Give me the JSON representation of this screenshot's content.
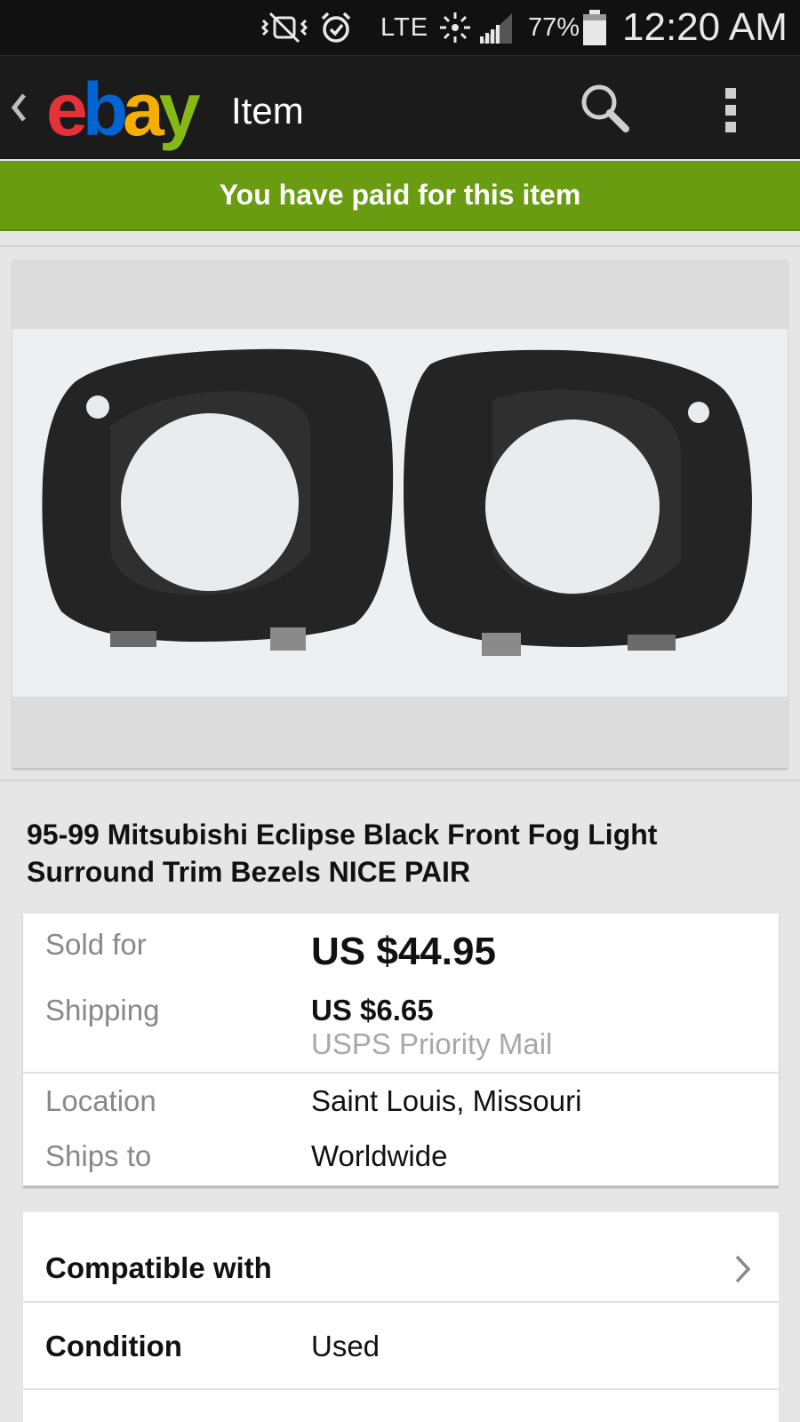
{
  "status_bar": {
    "network": "LTE",
    "battery_percent": "77%",
    "time": "12:20 AM",
    "icons": [
      "mute-vibrate-icon",
      "alarm-icon",
      "sync-icon",
      "signal-icon",
      "battery-icon"
    ]
  },
  "action_bar": {
    "logo": "ebay",
    "title": "Item",
    "icons": [
      "back-chevron-icon",
      "search-icon",
      "overflow-menu-icon"
    ]
  },
  "banner": {
    "text": "You have paid for this item",
    "color": "#699c10"
  },
  "item": {
    "title": "95-99 Mitsubishi Eclipse Black Front Fog Light Surround Trim Bezels NICE PAIR"
  },
  "pricing": {
    "sold_label": "Sold for",
    "sold_value": "US $44.95",
    "shipping_label": "Shipping",
    "shipping_value": "US $6.65",
    "shipping_method": "USPS Priority Mail",
    "location_label": "Location",
    "location_value": "Saint Louis, Missouri",
    "ships_to_label": "Ships to",
    "ships_to_value": "Worldwide"
  },
  "details": {
    "compatible_label": "Compatible with",
    "condition_label": "Condition",
    "condition_value": "Used"
  },
  "colors": {
    "ebay_red": "#e53238",
    "ebay_blue": "#0064d2",
    "ebay_yellow": "#f5af02",
    "ebay_green": "#86b817"
  }
}
